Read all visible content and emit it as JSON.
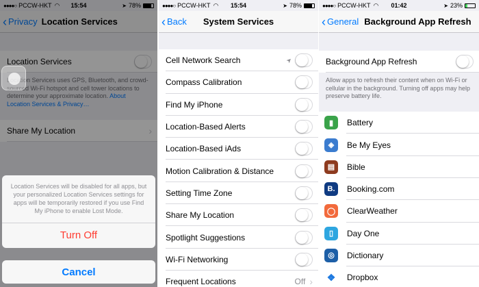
{
  "colors": {
    "accent": "#007aff",
    "destructive": "#ff3b30",
    "background": "#efeff4"
  },
  "panel1": {
    "status": {
      "carrier": "PCCW-HKT",
      "time": "15:54",
      "battery": "78%",
      "battery_level": 0.78
    },
    "nav": {
      "back_label": "Privacy",
      "title": "Location Services"
    },
    "location_services_label": "Location Services",
    "description": "Location Services uses GPS, Bluetooth, and crowd-sourced Wi-Fi hotspot and cell tower locations to determine your approximate location.",
    "about_link": "About Location Services & Privacy…",
    "share_my_location": "Share My Location",
    "alert": {
      "message": "Location Services will be disabled for all apps, but your personalized Location Services settings for apps will be temporarily restored if you use Find My iPhone to enable Lost Mode.",
      "turn_off_label": "Turn Off",
      "cancel_label": "Cancel"
    }
  },
  "panel2": {
    "status": {
      "carrier": "PCCW-HKT",
      "time": "15:54",
      "battery": "78%",
      "battery_level": 0.78
    },
    "nav": {
      "back_label": "Back",
      "title": "System Services"
    },
    "rows": [
      {
        "label": "Cell Network Search",
        "indicator": "location-arrow-icon"
      },
      {
        "label": "Compass Calibration"
      },
      {
        "label": "Find My iPhone"
      },
      {
        "label": "Location-Based Alerts"
      },
      {
        "label": "Location-Based iAds"
      },
      {
        "label": "Motion Calibration & Distance"
      },
      {
        "label": "Setting Time Zone"
      },
      {
        "label": "Share My Location"
      },
      {
        "label": "Spotlight Suggestions"
      },
      {
        "label": "Wi-Fi Networking"
      }
    ],
    "frequent_locations": {
      "label": "Frequent Locations",
      "value": "Off"
    }
  },
  "panel3": {
    "status": {
      "carrier": "PCCW-HKT",
      "time": "01:42",
      "battery": "23%",
      "battery_level": 0.23
    },
    "nav": {
      "back_label": "General",
      "title": "Background App Refresh"
    },
    "toggle_label": "Background App Refresh",
    "description": "Allow apps to refresh their content when on Wi-Fi or cellular in the background. Turning off apps may help preserve battery life.",
    "apps": [
      {
        "name": "Battery",
        "icon": "battery-app-icon",
        "color": "#3aa34a"
      },
      {
        "name": "Be My Eyes",
        "icon": "be-my-eyes-icon",
        "color": "#3b7ccf"
      },
      {
        "name": "Bible",
        "icon": "bible-icon",
        "color": "#8e3b1f"
      },
      {
        "name": "Booking.com",
        "icon": "booking-icon",
        "color": "#0f3b82"
      },
      {
        "name": "ClearWeather",
        "icon": "clearweather-icon",
        "color": "#f26a3c"
      },
      {
        "name": "Day One",
        "icon": "day-one-icon",
        "color": "#2ea6e0"
      },
      {
        "name": "Dictionary",
        "icon": "dictionary-icon",
        "color": "#1d5fa7"
      },
      {
        "name": "Dropbox",
        "icon": "dropbox-icon",
        "color": "#1f7ae0"
      }
    ]
  }
}
